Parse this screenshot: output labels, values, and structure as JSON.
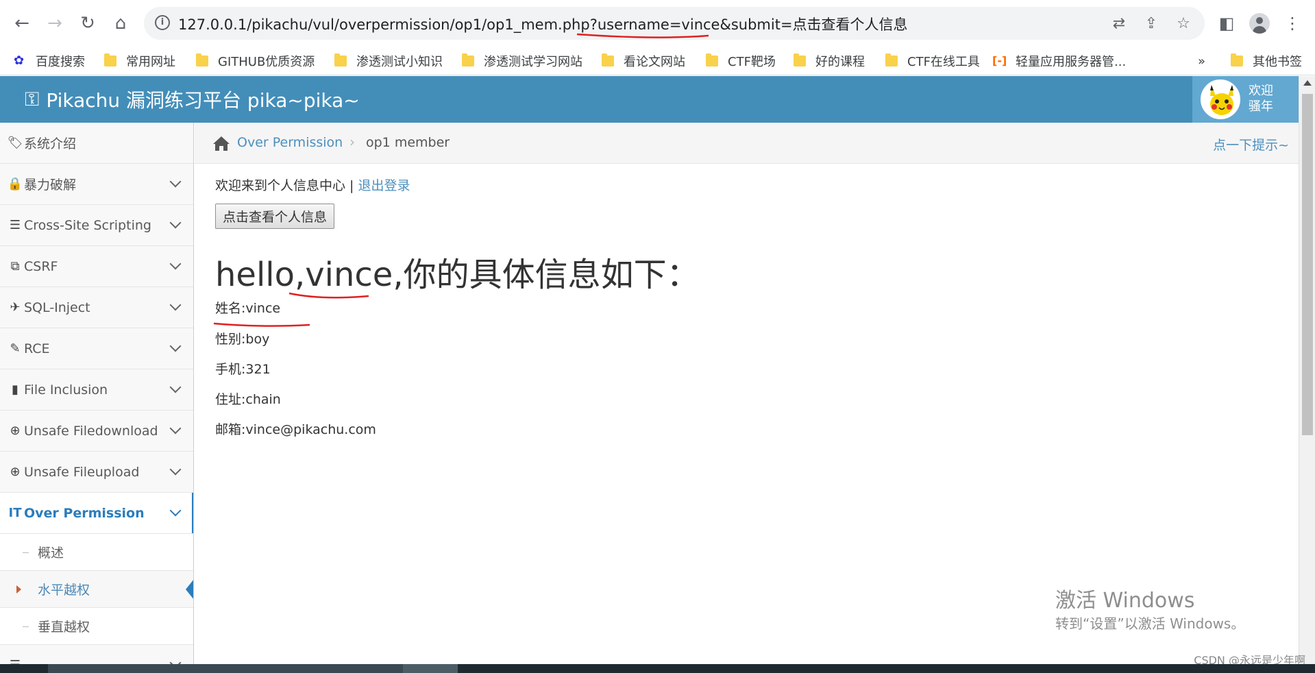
{
  "browser": {
    "url": "127.0.0.1/pikachu/vul/overpermission/op1/op1_mem.php?username=vince&submit=点击查看个人信息",
    "bookmarks": [
      {
        "label": "百度搜索",
        "icon": "baidu-icon"
      },
      {
        "label": "常用网址",
        "icon": "folder-icon"
      },
      {
        "label": "GITHUB优质资源",
        "icon": "folder-icon"
      },
      {
        "label": "渗透测试小知识",
        "icon": "folder-icon"
      },
      {
        "label": "渗透测试学习网站",
        "icon": "folder-icon"
      },
      {
        "label": "看论文网站",
        "icon": "folder-icon"
      },
      {
        "label": "CTF靶场",
        "icon": "folder-icon"
      },
      {
        "label": "好的课程",
        "icon": "folder-icon"
      },
      {
        "label": "CTF在线工具",
        "icon": "folder-icon"
      },
      {
        "label": "轻量应用服务器管...",
        "icon": "cloud-icon"
      }
    ],
    "overflow_label": "»",
    "other_bookmarks": "其他书签"
  },
  "header": {
    "title": "Pikachu 漏洞练习平台 pika~pika~",
    "greeting_line1": "欢迎",
    "greeting_line2": "骚年",
    "background_color": "#438eb9"
  },
  "sidebar": {
    "items": [
      {
        "label": "系统介绍",
        "icon": "tags-icon"
      },
      {
        "label": "暴力破解",
        "icon": "lock-icon"
      },
      {
        "label": "Cross-Site Scripting",
        "icon": "list-icon"
      },
      {
        "label": "CSRF",
        "icon": "external-link-icon"
      },
      {
        "label": "SQL-Inject",
        "icon": "plane-icon"
      },
      {
        "label": "RCE",
        "icon": "pencil-icon"
      },
      {
        "label": "File Inclusion",
        "icon": "file-icon"
      },
      {
        "label": "Unsafe Filedownload",
        "icon": "download-icon"
      },
      {
        "label": "Unsafe Fileupload",
        "icon": "upload-icon"
      },
      {
        "label": "Over Permission",
        "icon": "text-height-icon"
      }
    ],
    "subitems": [
      {
        "label": "概述"
      },
      {
        "label": "水平越权"
      },
      {
        "label": "垂直越权"
      }
    ],
    "active_color": "#2b7dbc"
  },
  "breadcrumb": {
    "parent": "Over Permission",
    "current": "op1 member",
    "hint": "点一下提示~"
  },
  "main": {
    "welcome_text": "欢迎来到个人信息中心 | ",
    "logout": "退出登录",
    "button_label": "点击查看个人信息",
    "heading": "hello,vince,你的具体信息如下：",
    "fields": [
      "姓名:vince",
      "性别:boy",
      "手机:321",
      "住址:chain",
      "邮箱:vince@pikachu.com"
    ]
  },
  "watermark": {
    "title": "激活 Windows",
    "subtitle": "转到“设置”以激活 Windows。",
    "csdn": "CSDN @永远是少年啊"
  }
}
